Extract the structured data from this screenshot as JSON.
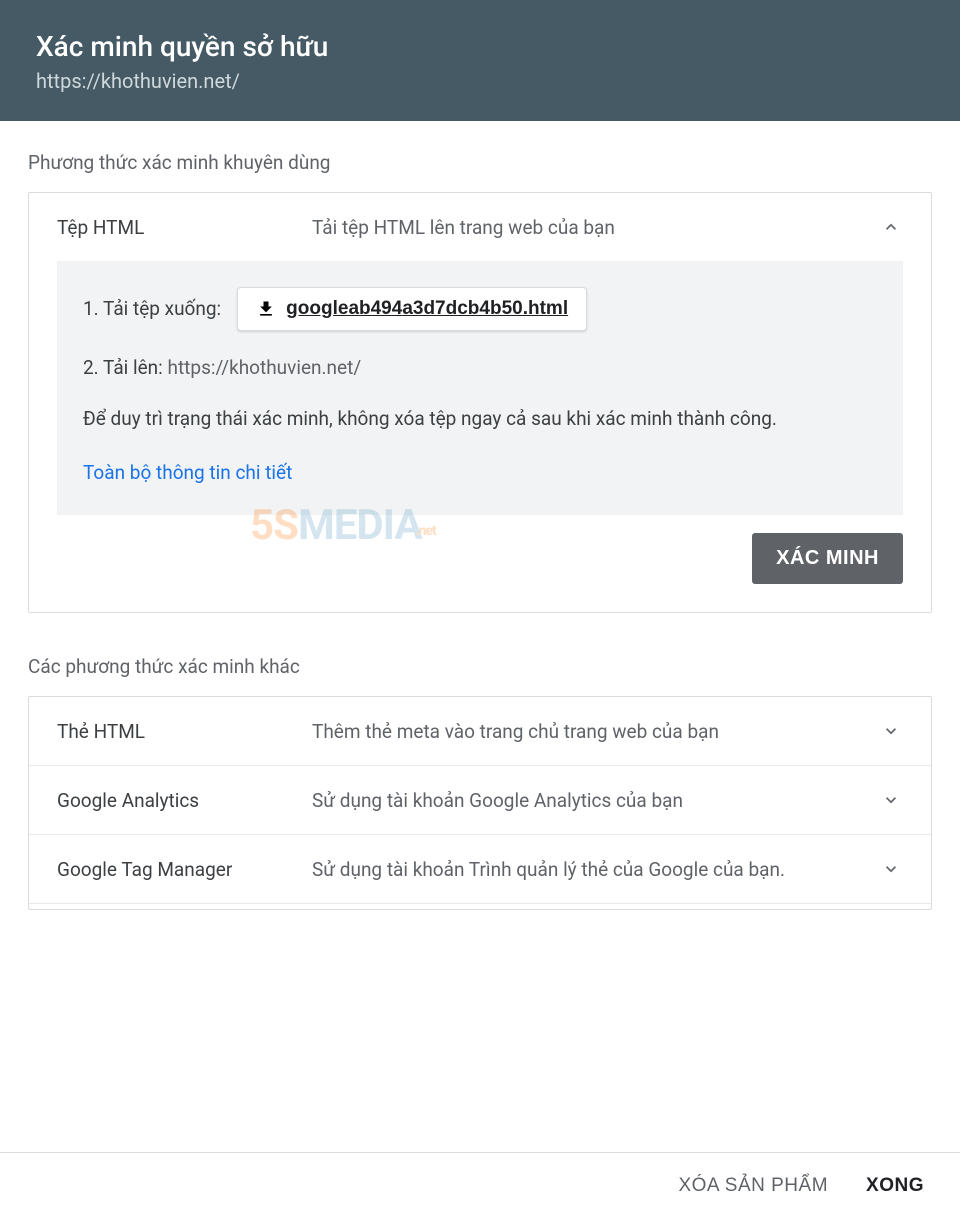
{
  "header": {
    "title": "Xác minh quyền sở hữu",
    "url": "https://khothuvien.net/"
  },
  "recommended": {
    "section_label": "Phương thức xác minh khuyên dùng",
    "method_title": "Tệp HTML",
    "method_desc": "Tải tệp HTML lên trang web của bạn",
    "step1_label": "1. Tải tệp xuống:",
    "download_filename": "googleab494a3d7dcb4b50.html",
    "step2_label": "2. Tải lên:",
    "step2_url": "https://khothuvien.net/",
    "note": "Để duy trì trạng thái xác minh, không xóa tệp ngay cả sau khi xác minh thành công.",
    "full_details": "Toàn bộ thông tin chi tiết",
    "verify_button": "XÁC MINH"
  },
  "other": {
    "section_label": "Các phương thức xác minh khác",
    "methods": [
      {
        "title": "Thẻ HTML",
        "desc": "Thêm thẻ meta vào trang chủ trang web của bạn"
      },
      {
        "title": "Google Analytics",
        "desc": "Sử dụng tài khoản Google Analytics của bạn"
      },
      {
        "title": "Google Tag Manager",
        "desc": "Sử dụng tài khoản Trình quản lý thẻ của Google của bạn."
      }
    ]
  },
  "footer": {
    "remove": "XÓA SẢN PHẨM",
    "done": "XONG"
  },
  "watermark": {
    "a": "5S",
    "b": "MEDIA",
    "c": ".net"
  }
}
